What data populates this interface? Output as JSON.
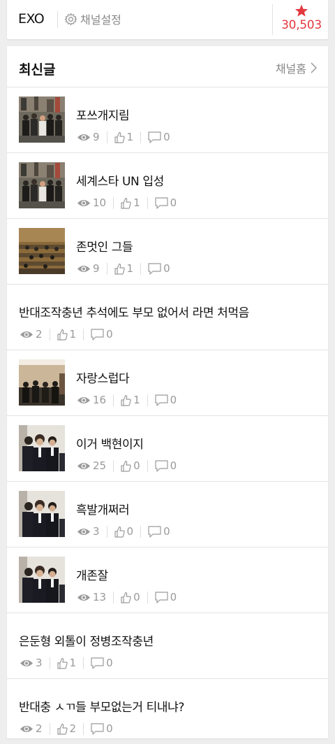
{
  "header": {
    "channel_name": "EXO",
    "settings_label": "채널설정",
    "star_count": "30,503"
  },
  "latest": {
    "title": "최신글",
    "home_link": "채널홈"
  },
  "posts": [
    {
      "title": "포쓰개지림",
      "views": "9",
      "likes": "1",
      "comments": "0",
      "thumb": "crowd"
    },
    {
      "title": "세계스타 UN 입성",
      "views": "10",
      "likes": "1",
      "comments": "0",
      "thumb": "crowd"
    },
    {
      "title": "존멋인 그들",
      "views": "9",
      "likes": "1",
      "comments": "0",
      "thumb": "hall"
    },
    {
      "title": "반대조작충년 추석에도 부모 없어서 라면 처먹음",
      "views": "2",
      "likes": "1",
      "comments": "0",
      "thumb": ""
    },
    {
      "title": "자랑스럽다",
      "views": "16",
      "likes": "1",
      "comments": "0",
      "thumb": "room"
    },
    {
      "title": "이거 백현이지",
      "views": "25",
      "likes": "0",
      "comments": "0",
      "thumb": "suits"
    },
    {
      "title": "흑발개쩌러",
      "views": "3",
      "likes": "0",
      "comments": "0",
      "thumb": "suits"
    },
    {
      "title": "개존잘",
      "views": "13",
      "likes": "0",
      "comments": "0",
      "thumb": "suits"
    },
    {
      "title": "은둔형 외톨이 정병조작충년",
      "views": "3",
      "likes": "1",
      "comments": "0",
      "thumb": ""
    },
    {
      "title": "반대충 ㅅㄲ들 부모없는거 티내냐?",
      "views": "2",
      "likes": "2",
      "comments": "0",
      "thumb": ""
    }
  ]
}
